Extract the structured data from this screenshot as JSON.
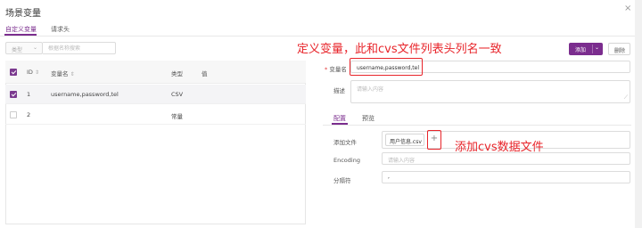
{
  "dialog": {
    "title": "场景变量",
    "close_icon": "×"
  },
  "tabs": [
    {
      "label": "自定义变量",
      "active": true
    },
    {
      "label": "请求头",
      "active": false
    }
  ],
  "filter": {
    "type_label": "类型",
    "search_placeholder": "根据名称搜索"
  },
  "table": {
    "headers": {
      "id": "ID",
      "var_name": "变量名",
      "type": "类型",
      "value": "值",
      "sort_glyph": "⇕"
    },
    "rows": [
      {
        "id": "1",
        "name": "username,password,tel",
        "type": "CSV",
        "value": "",
        "selected": true
      },
      {
        "id": "2",
        "name": "",
        "type": "常量",
        "value": "",
        "selected": false
      }
    ]
  },
  "toolbar": {
    "add_label": "添加",
    "delete_label": "删除"
  },
  "form": {
    "var_name_label": "变量名",
    "var_name_value": "username,password,tel",
    "desc_label": "描述",
    "desc_placeholder": "请输入内容",
    "sub_tabs": [
      {
        "label": "配置",
        "active": true
      },
      {
        "label": "预览",
        "active": false
      }
    ],
    "add_file_label": "添加文件",
    "file_name": "用户信息.csv",
    "encoding_label": "Encoding",
    "encoding_placeholder": "请输入内容",
    "separator_label": "分隔符",
    "separator_value": ","
  },
  "annotations": {
    "header_note": "定义变量，此和cvs文件列表头列名一致",
    "file_note": "添加cvs数据文件"
  },
  "colors": {
    "accent": "#7b2d8e",
    "annotation_red": "#e8242a"
  }
}
